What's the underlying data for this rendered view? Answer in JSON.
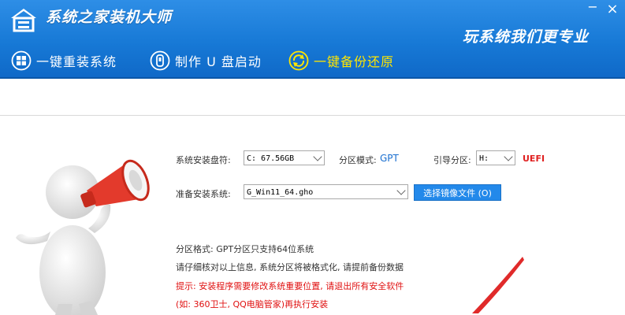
{
  "header": {
    "app_title": "系统之家装机大师",
    "slogan": "玩系统我们更专业",
    "minimize": "−",
    "close": "×",
    "colors": {
      "bg": "#1779d6",
      "active_tab": "#ffe600"
    }
  },
  "nav": {
    "tabs": [
      {
        "label": "一键重装系统",
        "icon": "windows-icon",
        "active": false
      },
      {
        "label": "制作 U 盘启动",
        "icon": "usb-icon",
        "active": false
      },
      {
        "label": "一键备份还原",
        "icon": "backup-restore-icon",
        "active": true
      }
    ]
  },
  "form": {
    "install_disk_label": "系统安装盘符:",
    "install_disk_value": "C: 67.56GB",
    "partition_mode_label": "分区模式:",
    "partition_mode_value": "GPT",
    "boot_partition_label": "引导分区:",
    "boot_partition_value": "H:",
    "boot_type": "UEFI",
    "prepare_system_label": "准备安装系统:",
    "prepare_system_value": "G_Win11_64.gho",
    "choose_image_button": "选择镜像文件 (O)"
  },
  "info": {
    "line1": "分区格式: GPT分区只支持64位系统",
    "line2": "请仔细核对以上信息, 系统分区将被格式化, 请提前备份数据",
    "line3": "提示: 安装程序需要修改系统重要位置, 请退出所有安全软件",
    "line4": "(如: 360卫士, QQ电脑管家)再执行安装"
  }
}
